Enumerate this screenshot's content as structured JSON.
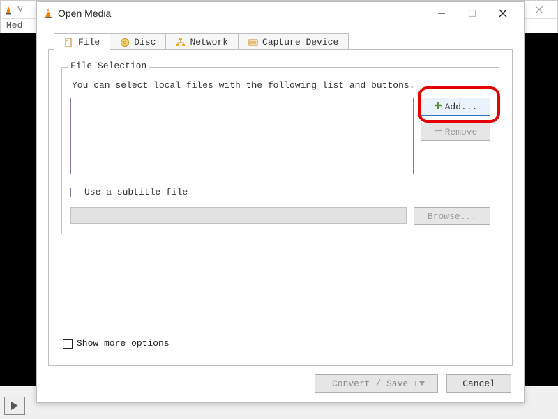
{
  "main_window": {
    "title_fragment": "V",
    "menu_item": "Med"
  },
  "dialog": {
    "title": "Open Media",
    "tabs": {
      "file": "File",
      "disc": "Disc",
      "network": "Network",
      "capture": "Capture Device"
    },
    "file_selection_legend": "File Selection",
    "file_selection_hint": "You can select local files with the following list and buttons.",
    "add_button": "Add...",
    "remove_button": "Remove",
    "use_subtitle_label": "Use a subtitle file",
    "browse_button": "Browse...",
    "show_more_options": "Show more options",
    "convert_save": "Convert / Save",
    "cancel": "Cancel"
  }
}
